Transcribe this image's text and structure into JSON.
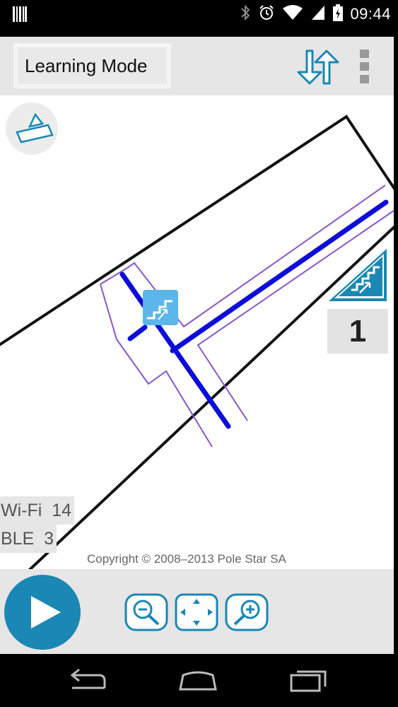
{
  "status_bar": {
    "time": "09:44",
    "icons": [
      "notification-barcode-icon",
      "bluetooth-icon",
      "alarm-icon",
      "wifi-icon",
      "signal-icon",
      "battery-icon"
    ]
  },
  "app_bar": {
    "mode_label": "Learning Mode",
    "icons": [
      "swap-arrows-icon",
      "overflow-menu-icon"
    ]
  },
  "map": {
    "floor_number": "1",
    "wifi_label": "Wi-Fi",
    "wifi_count": "14",
    "ble_label": "BLE",
    "ble_count": "3",
    "copyright": "Copyright © 2008–2013 Pole Star SA",
    "icons": [
      "layers-icon",
      "stairs-icon",
      "stairs-marker-icon"
    ],
    "colors": {
      "route": "#0d0dd9",
      "corridor": "#8a55c9",
      "building": "#111111",
      "accent": "#1a87b4"
    }
  },
  "bottom_bar": {
    "icons": [
      "play-icon",
      "zoom-out-icon",
      "fit-view-icon",
      "zoom-in-icon"
    ]
  },
  "nav_bar": {
    "icons": [
      "back-icon",
      "home-icon",
      "recent-apps-icon"
    ]
  }
}
